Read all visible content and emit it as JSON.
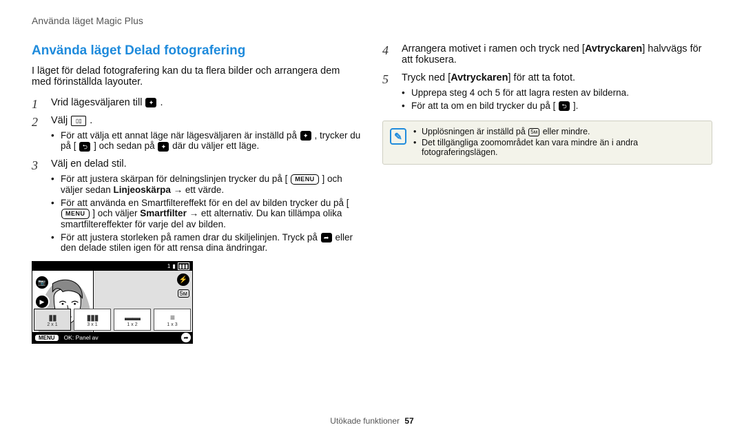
{
  "header": {
    "running": "Använda läget Magic Plus"
  },
  "section_heading": "Använda läget Delad fotografering",
  "intro": "I läget för delad fotografering kan du ta flera bilder och arrangera dem med förinställda layouter.",
  "steps": {
    "s1_pre": "Vrid lägesväljaren till ",
    "s1_post": ".",
    "s2_pre": "Välj ",
    "s2_post": ".",
    "s2_sub_a_pre": "För att välja ett annat läge när lägesväljaren är inställd på ",
    "s2_sub_a_mid": ", trycker du på [",
    "s2_sub_a_mid2": "] och sedan på ",
    "s2_sub_a_post": " där du väljer ett läge.",
    "s3": "Välj en delad stil.",
    "s3_sub_a_pre": "För att justera skärpan för delningslinjen trycker du på [",
    "s3_sub_a_mid": "] och väljer sedan ",
    "s3_sub_a_bold": "Linjeoskärpa",
    "s3_sub_a_post": " → ett värde.",
    "s3_sub_b_pre": "För att använda en Smartfiltereffekt för en del av bilden trycker du på [",
    "s3_sub_b_mid": "] och väljer ",
    "s3_sub_b_bold": "Smartfilter",
    "s3_sub_b_post": " → ett alternativ. Du kan tillämpa olika smartfiltereffekter för varje del av bilden.",
    "s3_sub_c_pre": "För att justera storleken på ramen drar du skiljelinjen. Tryck på ",
    "s3_sub_c_post": " eller den delade stilen igen för att rensa dina ändringar.",
    "s4_pre": "Arrangera motivet i ramen och tryck ned [",
    "s4_bold": "Avtryckaren",
    "s4_post": "] halvvägs för att fokusera.",
    "s5_pre": "Tryck ned [",
    "s5_bold": "Avtryckaren",
    "s5_post": "] för att ta fotot.",
    "s5_sub_a": "Upprepa steg 4 och 5 för att lagra resten av bilderna.",
    "s5_sub_b_pre": "För att ta om en bild trycker du på [",
    "s5_sub_b_post": "]."
  },
  "step_numbers": {
    "n1": "1",
    "n2": "2",
    "n3": "3",
    "n4": "4",
    "n5": "5"
  },
  "note": {
    "a_pre": "Upplösningen är inställd på ",
    "a_post": " eller mindre.",
    "b": "Det tillgängliga zoomområdet kan vara mindre än i andra fotograferingslägen."
  },
  "diagram": {
    "top_batt": "1",
    "thumbs": [
      {
        "g": "▮▮",
        "l": "2 x 1"
      },
      {
        "g": "▮▮▮",
        "l": "3 x 1"
      },
      {
        "g": "▬▬",
        "l": "1 x 2"
      },
      {
        "g": "≡",
        "l": "1 x 3"
      }
    ],
    "menu_label": "MENU",
    "ok_label": "OK: Panel av"
  },
  "icons": {
    "menu_pill": "MENU",
    "res_5m": "5м"
  },
  "footer": {
    "label": "Utökade funktioner",
    "page": "57"
  }
}
